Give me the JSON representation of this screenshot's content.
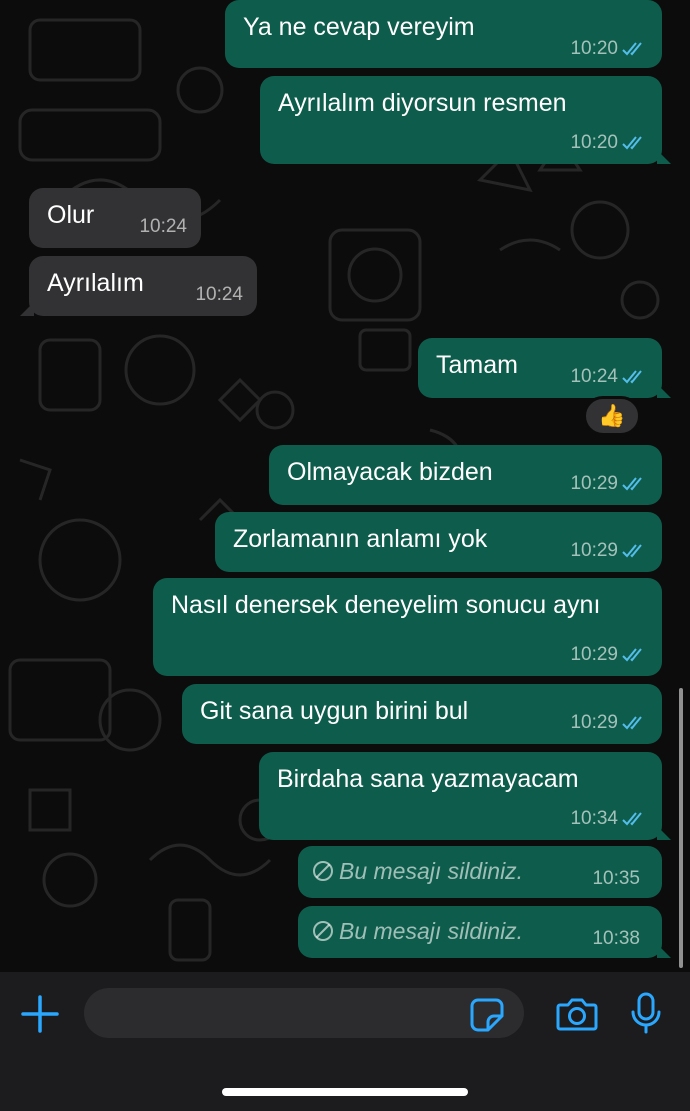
{
  "messages": [
    {
      "text": "Ya ne cevap vereyim",
      "time": "10:20",
      "direction": "outgoing",
      "status": "read"
    },
    {
      "text": "Ayrılalım  diyorsun resmen",
      "time": "10:20",
      "direction": "outgoing",
      "status": "read"
    },
    {
      "text": "Olur",
      "time": "10:24",
      "direction": "incoming"
    },
    {
      "text": "Ayrılalım",
      "time": "10:24",
      "direction": "incoming"
    },
    {
      "text": "Tamam",
      "time": "10:24",
      "direction": "outgoing",
      "status": "read",
      "reaction": "👍"
    },
    {
      "text": "Olmayacak bizden",
      "time": "10:29",
      "direction": "outgoing",
      "status": "read"
    },
    {
      "text": "Zorlamanın anlamı yok",
      "time": "10:29",
      "direction": "outgoing",
      "status": "read"
    },
    {
      "text": "Nasıl denersek deneyelim sonucu aynı",
      "time": "10:29",
      "direction": "outgoing",
      "status": "read"
    },
    {
      "text": "Git sana uygun birini bul",
      "time": "10:29",
      "direction": "outgoing",
      "status": "read"
    },
    {
      "text": "Birdaha sana yazmayacam",
      "time": "10:34",
      "direction": "outgoing",
      "status": "read"
    },
    {
      "text": "Bu mesajı sildiniz.",
      "time": "10:35",
      "direction": "outgoing",
      "deleted": true
    },
    {
      "text": "Bu mesajı sildiniz.",
      "time": "10:38",
      "direction": "outgoing",
      "deleted": true
    }
  ],
  "colors": {
    "outgoing_bubble": "#0e5c4b",
    "incoming_bubble": "#323234",
    "read_ticks": "#53bdeb",
    "accent_icons": "#2aa7ff",
    "background": "#0c0c0c"
  },
  "composer": {
    "icons": [
      "plus-icon",
      "sticker-icon",
      "camera-icon",
      "microphone-icon"
    ]
  }
}
